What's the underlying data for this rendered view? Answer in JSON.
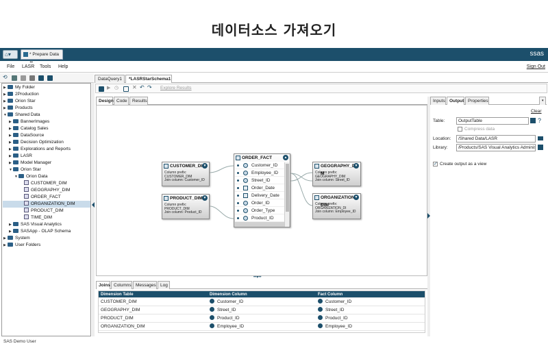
{
  "heading": "데이터소스 가져오기",
  "topbar": {
    "tab_label": "* Prepare Data",
    "logo": "ssas"
  },
  "menu": [
    "File",
    "LASR",
    "Tools",
    "Help"
  ],
  "sign_out": "Sign Out",
  "tree": [
    {
      "label": "My Folder",
      "level": 0,
      "icon": "folder",
      "toggle": "▶"
    },
    {
      "label": "2Production",
      "level": 0,
      "icon": "folder",
      "toggle": "▶"
    },
    {
      "label": "Orion Star",
      "level": 0,
      "icon": "folder",
      "toggle": "▶"
    },
    {
      "label": "Products",
      "level": 0,
      "icon": "folder",
      "toggle": "▶"
    },
    {
      "label": "Shared Data",
      "level": 0,
      "icon": "folder",
      "toggle": "▼"
    },
    {
      "label": "BannerImages",
      "level": 1,
      "icon": "folder",
      "toggle": "▶"
    },
    {
      "label": "Catalog Sales",
      "level": 1,
      "icon": "folder",
      "toggle": "▶"
    },
    {
      "label": "DataSource",
      "level": 1,
      "icon": "folder",
      "toggle": "▶"
    },
    {
      "label": "Decision Optimization",
      "level": 1,
      "icon": "folder",
      "toggle": "▶"
    },
    {
      "label": "Explorations and Reports",
      "level": 1,
      "icon": "folder",
      "toggle": "▶"
    },
    {
      "label": "LASR",
      "level": 1,
      "icon": "folder",
      "toggle": "▶"
    },
    {
      "label": "Model Manager",
      "level": 1,
      "icon": "folder",
      "toggle": "▶"
    },
    {
      "label": "Orion Star",
      "level": 1,
      "icon": "folder",
      "toggle": "▼"
    },
    {
      "label": "Orion Data",
      "level": 2,
      "icon": "folder",
      "toggle": "▼"
    },
    {
      "label": "CUSTOMER_DIM",
      "level": 3,
      "icon": "table",
      "toggle": ""
    },
    {
      "label": "GEOGRAPHY_DIM",
      "level": 3,
      "icon": "table",
      "toggle": ""
    },
    {
      "label": "ORDER_FACT",
      "level": 3,
      "icon": "table",
      "toggle": ""
    },
    {
      "label": "ORGANIZATION_DIM",
      "level": 3,
      "icon": "table",
      "toggle": "",
      "selected": true
    },
    {
      "label": "PRODUCT_DIM",
      "level": 3,
      "icon": "table",
      "toggle": ""
    },
    {
      "label": "TIME_DIM",
      "level": 3,
      "icon": "table",
      "toggle": ""
    },
    {
      "label": "SAS Visual Analytics",
      "level": 1,
      "icon": "folder",
      "toggle": "▶"
    },
    {
      "label": "SASApp - OLAP Schema",
      "level": 1,
      "icon": "folder",
      "toggle": "▶"
    },
    {
      "label": "System",
      "level": 0,
      "icon": "folder",
      "toggle": "▶"
    },
    {
      "label": "User Folders",
      "level": 0,
      "icon": "folder",
      "toggle": "▶"
    }
  ],
  "doc_tabs": [
    "DataQuery1",
    "*LASRStarSchema1"
  ],
  "explore_link": "Explore Results",
  "design_tabs": [
    "Design",
    "Code",
    "Results"
  ],
  "tables": {
    "customer": {
      "name": "CUSTOMER_DIM",
      "prefix": "Column prefix:",
      "prefix_val": "CUSTOMER_DIM",
      "join": "Join column: Customer_ID"
    },
    "product": {
      "name": "PRODUCT_DIM",
      "prefix": "Column prefix: PRODUCT_DIM",
      "prefix_val": "",
      "join": "Join column: Product_ID"
    },
    "geography": {
      "name": "GEOGRAPHY_DI M",
      "prefix": "Column prefix:",
      "prefix_val": "GEOGRAPHY_DIM",
      "join": "Join column: Street_ID"
    },
    "organization": {
      "name": "ORGANIZATION_ DIM",
      "prefix": "Column prefix:",
      "prefix_val": "ORGANIZATION_DI",
      "join": "Join column: Employee_ID"
    },
    "fact": {
      "name": "ORDER_FACT",
      "columns": [
        "Customer_ID",
        "Employee_ID",
        "Street_ID",
        "Order_Date",
        "Delivery_Date",
        "Order_ID",
        "Order_Type",
        "Product_ID"
      ]
    }
  },
  "bottom_tabs": [
    "Joins",
    "Columns",
    "Messages",
    "Log"
  ],
  "joins": {
    "headers": [
      "Dimension Table",
      "Dimension Column",
      "Fact Column"
    ],
    "rows": [
      [
        "CUSTOMER_DIM",
        "Customer_ID",
        "Customer_ID"
      ],
      [
        "GEOGRAPHY_DIM",
        "Street_ID",
        "Street_ID"
      ],
      [
        "PRODUCT_DIM",
        "Product_ID",
        "Product_ID"
      ],
      [
        "ORGANIZATION_DIM",
        "Employee_ID",
        "Employee_ID"
      ]
    ]
  },
  "prop_tabs": [
    "Inputs",
    "Output",
    "Properties"
  ],
  "props": {
    "clear": "Clear",
    "table_label": "Table:",
    "table_value": "OutputTable",
    "compress": "Compress data",
    "location_label": "Location:",
    "location_value": "/Shared Data/LASR",
    "library_label": "Library:",
    "library_value": "/Products/SAS Visual Analytics Administrato",
    "create_view": "Create output as a view"
  },
  "status": "SAS Demo User"
}
